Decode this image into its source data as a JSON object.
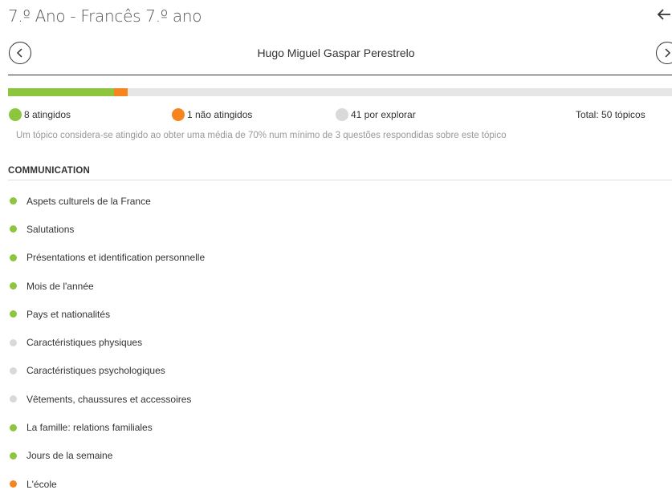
{
  "header": {
    "title": "7.º Ano - Francês 7.º ano",
    "back_icon": "arrow-left-icon",
    "prev_icon": "chevron-left-circle-icon",
    "next_icon": "chevron-right-circle-icon",
    "student_name": "Hugo Miguel Gaspar Perestrelo"
  },
  "colors": {
    "achieved": "#8cc63f",
    "not_achieved": "#f7851f",
    "to_explore": "#d9d9d9",
    "track": "#e6e6e6"
  },
  "progress": {
    "achieved_count": 8,
    "not_achieved_count": 1,
    "to_explore_count": 41,
    "total_count": 50
  },
  "legend": {
    "achieved_label": "8 atingidos",
    "not_achieved_label": "1 não atingidos",
    "to_explore_label": "41 por explorar",
    "total_label": "Total: 50 tópicos"
  },
  "note": "Um tópico considera-se atingido ao obter uma média de 70% num mínimo de 3 questões respondidas sobre este tópico",
  "section": {
    "title": "COMMUNICATION",
    "topics": [
      {
        "label": "Aspets culturels de la France",
        "status": "achieved"
      },
      {
        "label": "Salutations",
        "status": "achieved"
      },
      {
        "label": "Présentations et identification personnelle",
        "status": "achieved"
      },
      {
        "label": "Mois de l'année",
        "status": "achieved"
      },
      {
        "label": "Pays et nationalités",
        "status": "achieved"
      },
      {
        "label": "Caractéristiques physiques",
        "status": "to_explore"
      },
      {
        "label": "Caractéristiques psychologiques",
        "status": "to_explore"
      },
      {
        "label": "Vêtements, chaussures et accessoires",
        "status": "to_explore"
      },
      {
        "label": "La famille: relations familiales",
        "status": "achieved"
      },
      {
        "label": "Jours de la semaine",
        "status": "achieved"
      },
      {
        "label": "L'école",
        "status": "not_achieved"
      }
    ]
  }
}
